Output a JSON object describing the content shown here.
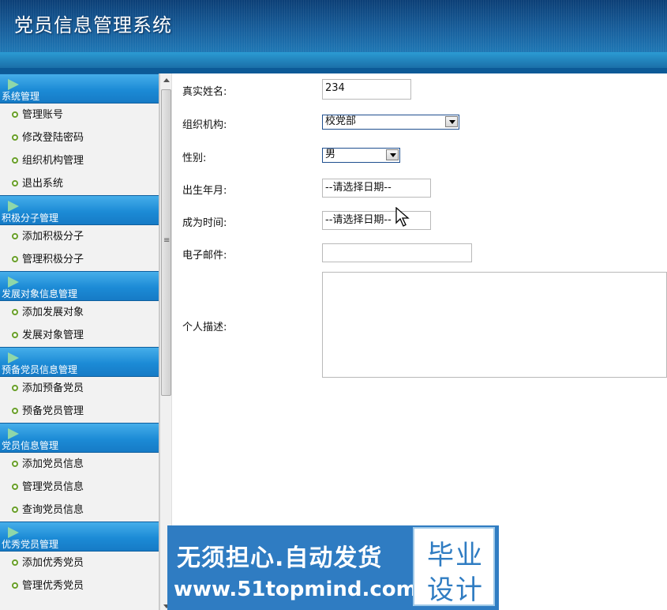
{
  "header": {
    "title": "党员信息管理系统"
  },
  "sidebar": {
    "sections": [
      {
        "title": "系统管理",
        "items": [
          "管理账号",
          "修改登陆密码",
          "组织机构管理",
          "退出系统"
        ]
      },
      {
        "title": "积极分子管理",
        "items": [
          "添加积极分子",
          "管理积极分子"
        ]
      },
      {
        "title": "发展对象信息管理",
        "items": [
          "添加发展对象",
          "发展对象管理"
        ]
      },
      {
        "title": "预备党员信息管理",
        "items": [
          "添加预备党员",
          "预备党员管理"
        ]
      },
      {
        "title": "党员信息管理",
        "items": [
          "添加党员信息",
          "管理党员信息",
          "查询党员信息"
        ]
      },
      {
        "title": "优秀党员管理",
        "items": [
          "添加优秀党员",
          "管理优秀党员"
        ]
      }
    ]
  },
  "form": {
    "real_name": {
      "label": "真实姓名:",
      "value": "234"
    },
    "org": {
      "label": "组织机构:",
      "value": "校党部"
    },
    "gender": {
      "label": "性别:",
      "value": "男"
    },
    "birth": {
      "label": "出生年月:",
      "value": "--请选择日期--"
    },
    "join_date": {
      "label": "成为时间:",
      "value": "--请选择日期--"
    },
    "email": {
      "label": "电子邮件:",
      "value": ""
    },
    "desc": {
      "label": "个人描述:",
      "value": ""
    }
  },
  "scrollbar": {
    "grip": "≡"
  },
  "banner": {
    "line1": "无须担心.自动发货",
    "line2": "www.51topmind.com",
    "badge_line1": "毕业",
    "badge_line2": "设计"
  },
  "colors": {
    "header_blue": "#1f77b4",
    "sidebar_header": "#1c8bd6",
    "bullet_green": "#6aa02a",
    "banner_blue": "#2f7cc2"
  }
}
